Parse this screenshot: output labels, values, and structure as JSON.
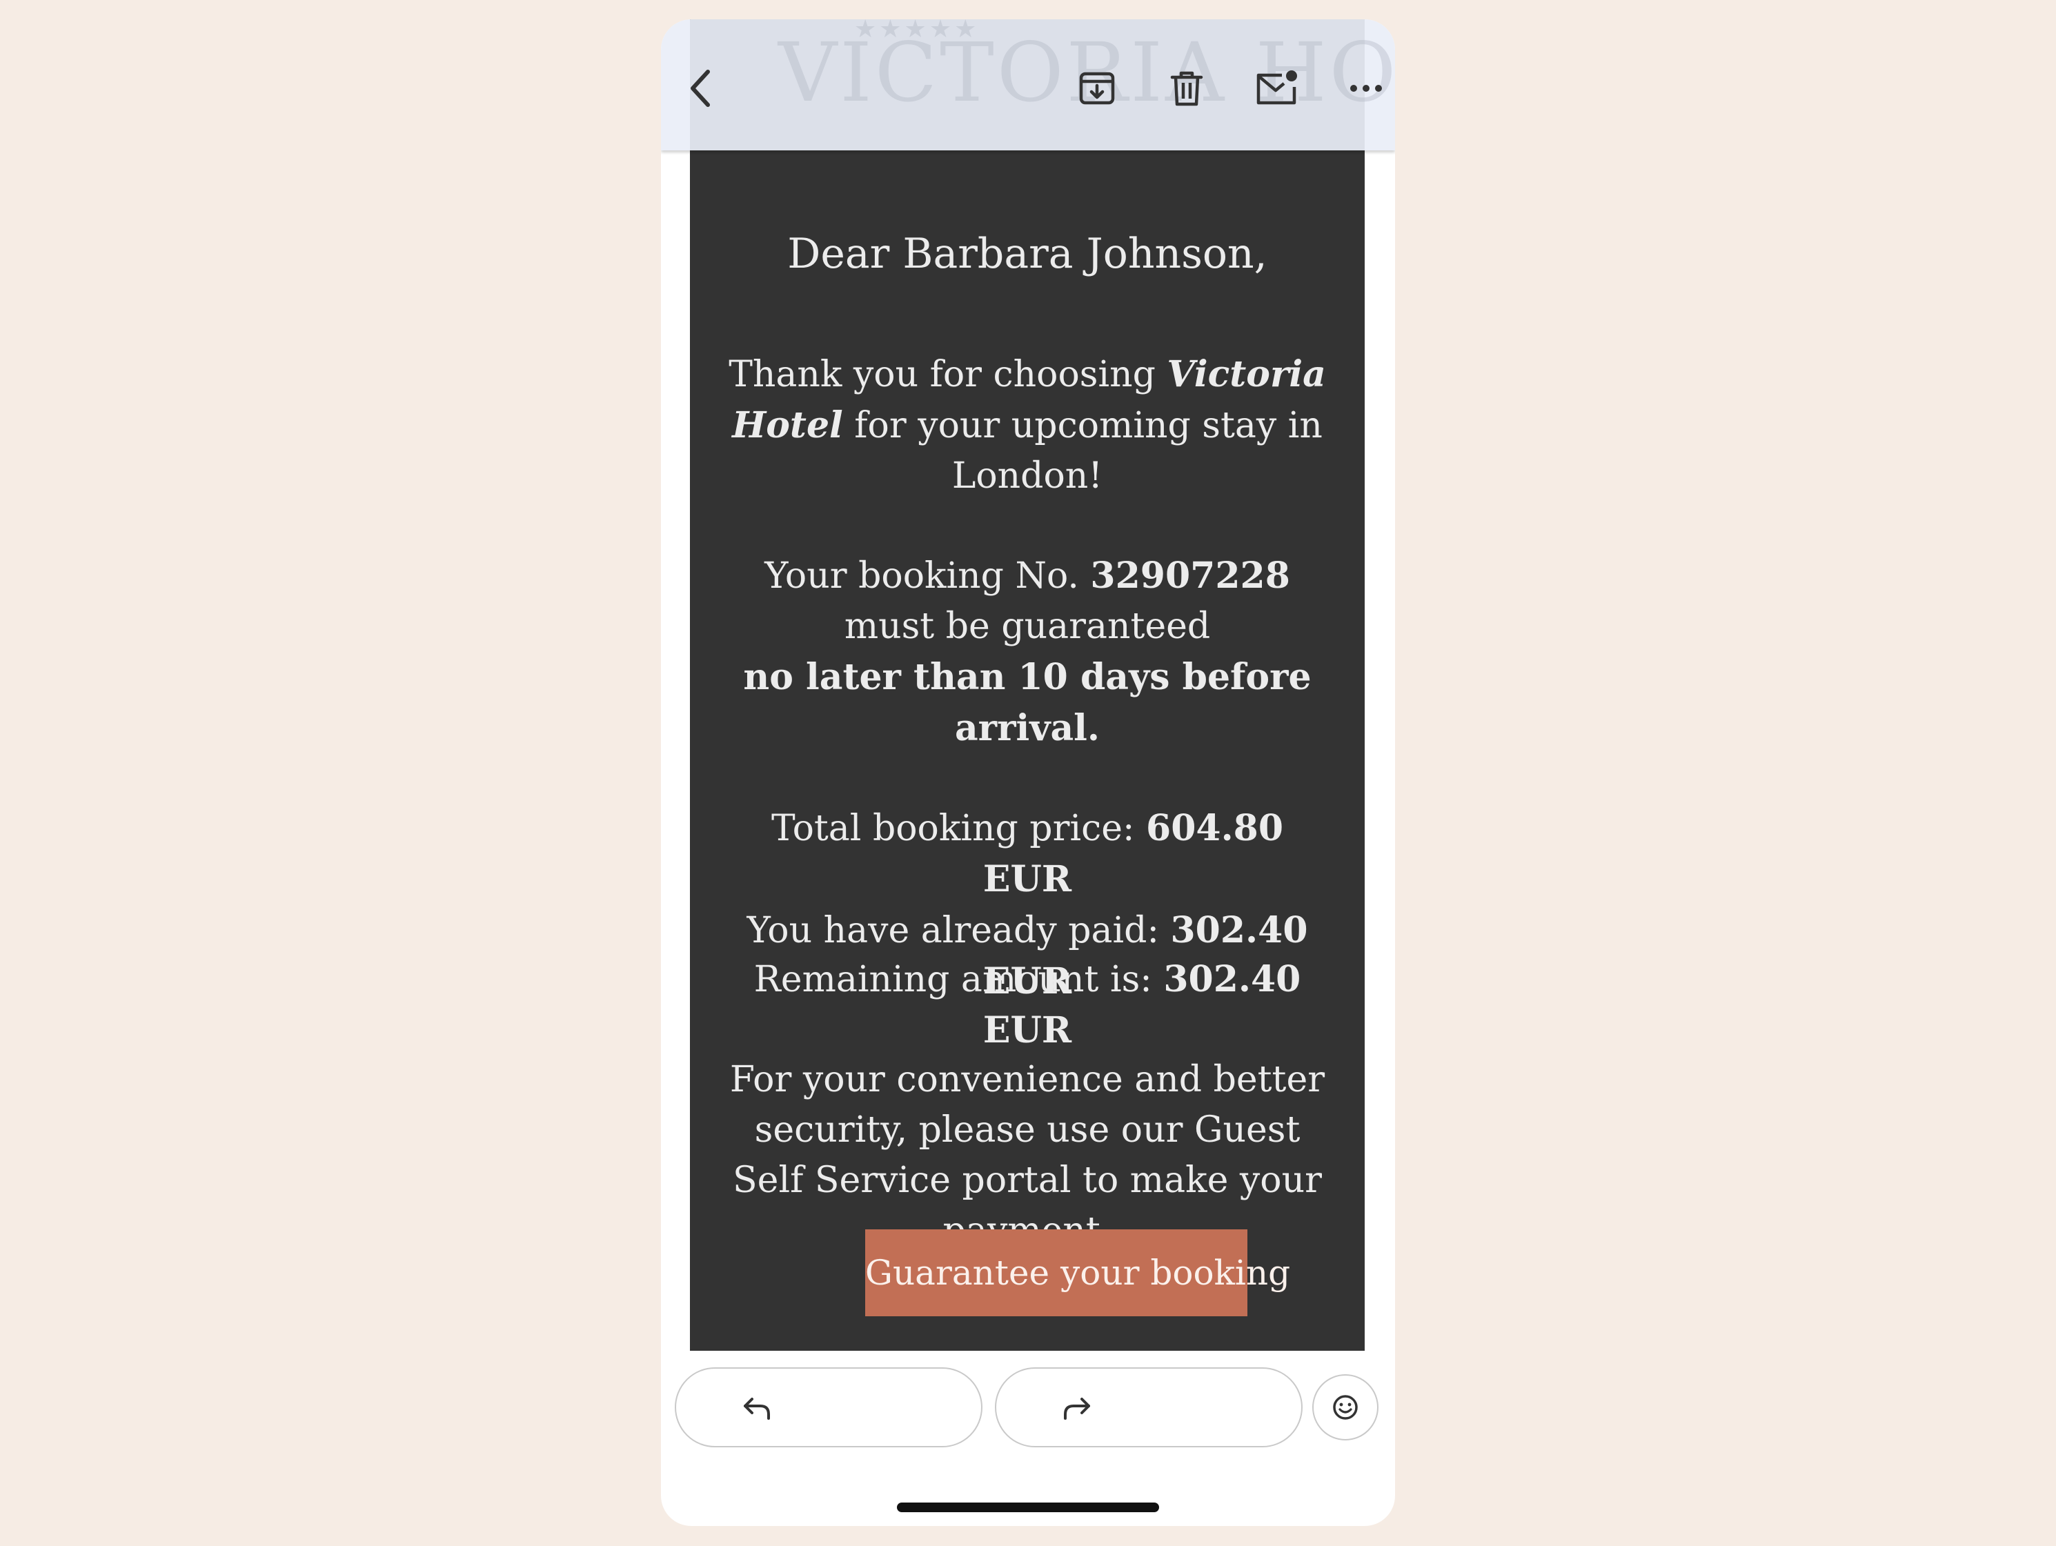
{
  "watermark": {
    "stars": "★★★★★",
    "logo_text": "VICTORIA HOTEL"
  },
  "toolbar": {
    "icons": {
      "back": "chevron-left-icon",
      "archive": "archive-box-icon",
      "delete": "trash-icon",
      "mark_unread": "mail-unread-icon",
      "more": "more-horizontal-icon"
    }
  },
  "email": {
    "greeting": "Dear Barbara Johnson,",
    "thanks": {
      "pre": "Thank you for choosing ",
      "hotel": "Victoria Hotel",
      "post": " for your upcoming stay in London!"
    },
    "booking": {
      "pre": "Your booking No. ",
      "number": "32907228",
      "mid": " must be guaranteed",
      "deadline": "no later than 10 days before arrival."
    },
    "prices": {
      "total_label": "Total booking price: ",
      "total_value": "604.80 EUR",
      "paid_label": "You have already paid: ",
      "paid_value": "302.40 EUR"
    },
    "remaining": {
      "label": "Remaining amount is: ",
      "value": "302.40 EUR"
    },
    "convenience": "For your convenience and better security, please use our Guest Self Service portal to make your payment.",
    "cta_label": "Guarantee your booking"
  },
  "bottom_bar": {
    "icons": {
      "reply": "reply-arrow-icon",
      "forward": "forward-arrow-icon",
      "react": "smiley-face-icon"
    }
  },
  "colors": {
    "page_background": "#f6ece4",
    "email_background": "#333333",
    "email_text": "#ececec",
    "cta_background": "#c26f55",
    "toolbar_background": "#e9eef7"
  }
}
